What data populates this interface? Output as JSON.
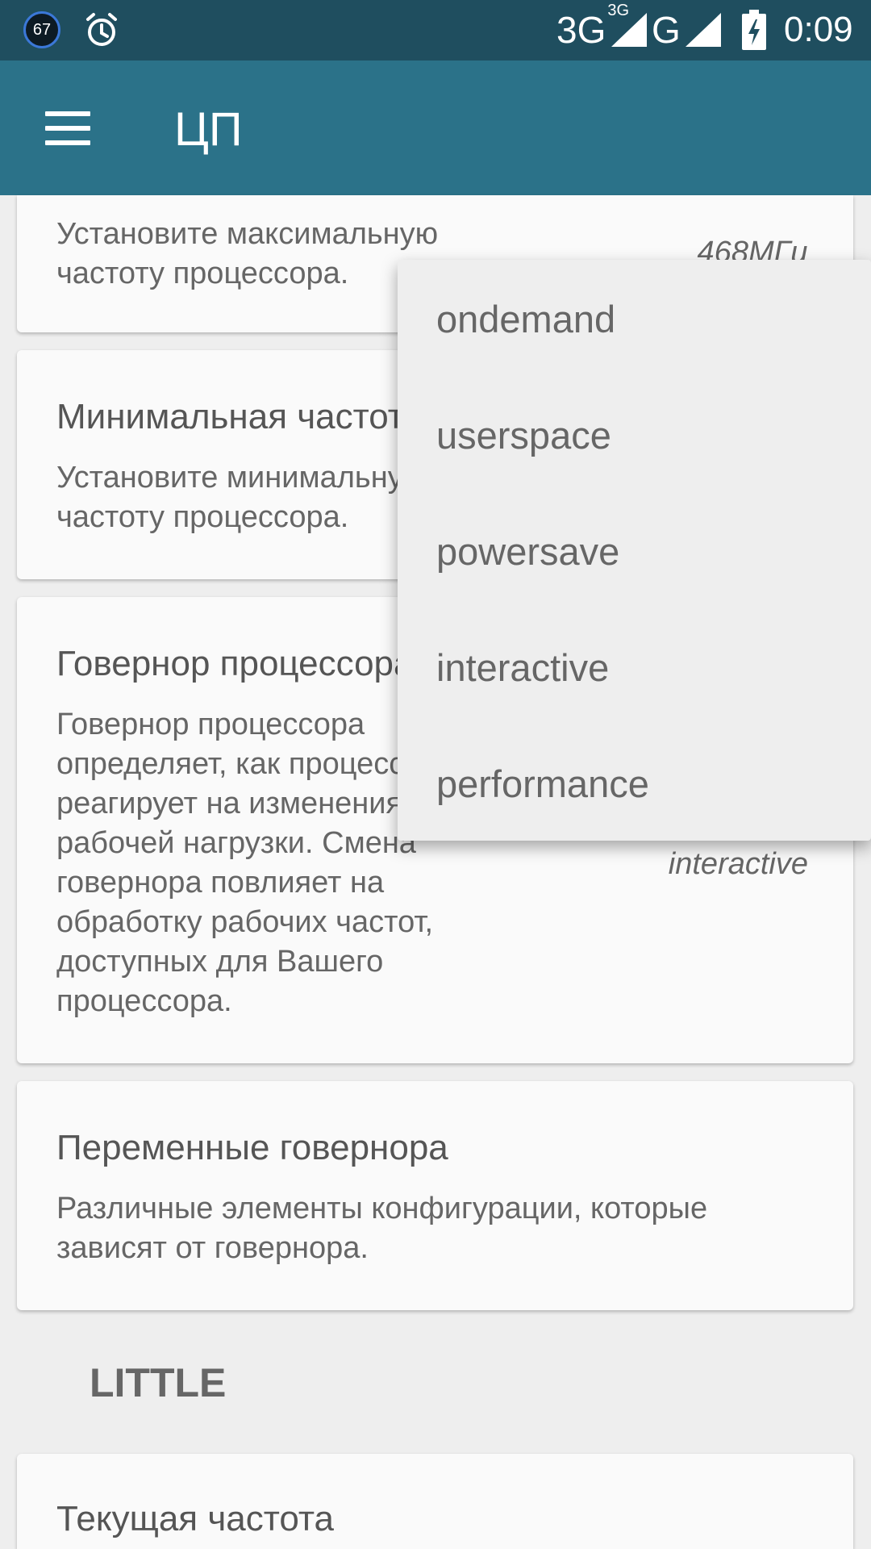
{
  "status_bar": {
    "badge": "67",
    "network_3g": "3G",
    "network_3g_super": "3G",
    "network_g": "G",
    "time": "0:09",
    "icons": [
      "notification-badge",
      "alarm-icon",
      "signal-icon",
      "battery-charging-icon"
    ]
  },
  "app_bar": {
    "title": "ЦП",
    "menu_icon": "hamburger-menu-icon"
  },
  "cards": {
    "max_freq": {
      "desc": "Установите максимальную частоту процессора.",
      "value": "468МГц"
    },
    "min_freq": {
      "title": "Минимальная частота",
      "desc": "Установите минимальную частоту процессора."
    },
    "governor": {
      "title": "Говернор процессора",
      "desc": "Говернор процессора определяет, как процессор реагирует на изменения рабочей нагрузки. Смена говернора повлияет на обработку рабочих частот, доступных для Вашего процессора.",
      "value": "interactive"
    },
    "governor_vars": {
      "title": "Переменные говернора",
      "desc": "Различные элементы конфигурации, которые зависят от говернора."
    },
    "current_freq": {
      "title": "Текущая частота"
    }
  },
  "section": {
    "label": "LITTLE"
  },
  "popup": {
    "options": [
      "ondemand",
      "userspace",
      "powersave",
      "interactive",
      "performance"
    ]
  }
}
